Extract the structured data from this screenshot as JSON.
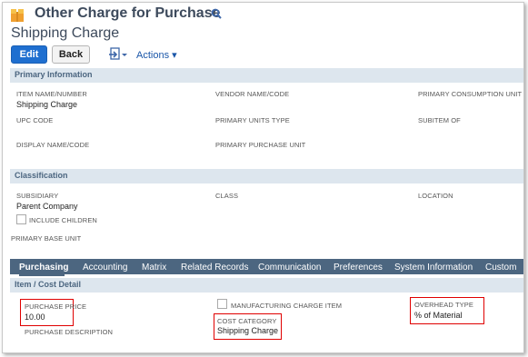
{
  "header": {
    "record_type": "Other Charge for Purchase",
    "record_name": "Shipping Charge"
  },
  "toolbar": {
    "edit_label": "Edit",
    "back_label": "Back",
    "actions_label": "Actions ▾"
  },
  "primary": {
    "section_title": "Primary Information",
    "item_name_label": "ITEM NAME/NUMBER",
    "item_name_value": "Shipping Charge",
    "vendor_name_label": "VENDOR NAME/CODE",
    "primary_consumption_label": "PRIMARY CONSUMPTION UNIT",
    "upc_label": "UPC CODE",
    "primary_units_type_label": "PRIMARY UNITS TYPE",
    "subitem_of_label": "SUBITEM OF",
    "display_name_label": "DISPLAY NAME/CODE",
    "primary_purchase_unit_label": "PRIMARY PURCHASE UNIT"
  },
  "classification": {
    "section_title": "Classification",
    "subsidiary_label": "SUBSIDIARY",
    "subsidiary_value": "Parent Company",
    "include_children_label": "INCLUDE CHILDREN",
    "class_label": "CLASS",
    "location_label": "LOCATION",
    "primary_base_unit_label": "PRIMARY BASE UNIT"
  },
  "tabs": [
    {
      "label": "Purchasing"
    },
    {
      "label": "Accounting"
    },
    {
      "label": "Matrix"
    },
    {
      "label": "Related Records"
    },
    {
      "label": "Communication"
    },
    {
      "label": "Preferences"
    },
    {
      "label": "System Information"
    },
    {
      "label": "Custom"
    }
  ],
  "cost_detail": {
    "section_title": "Item / Cost Detail",
    "purchase_price_label": "PURCHASE PRICE",
    "purchase_price_value": "10.00",
    "purchase_description_label": "PURCHASE DESCRIPTION",
    "manufacturing_charge_label": "MANUFACTURING CHARGE ITEM",
    "cost_category_label": "COST CATEGORY",
    "cost_category_value": "Shipping Charge",
    "overhead_type_label": "OVERHEAD TYPE",
    "overhead_type_value": "% of Material"
  },
  "icons": {
    "record": "record-type-icon",
    "search": "search-icon",
    "nav": "new-record-dropdown-icon"
  },
  "colors": {
    "button_primary": "#1f6fd0",
    "section_bar": "#dde6ee",
    "tab_bar": "#4c6680",
    "highlight": "#e00000"
  }
}
